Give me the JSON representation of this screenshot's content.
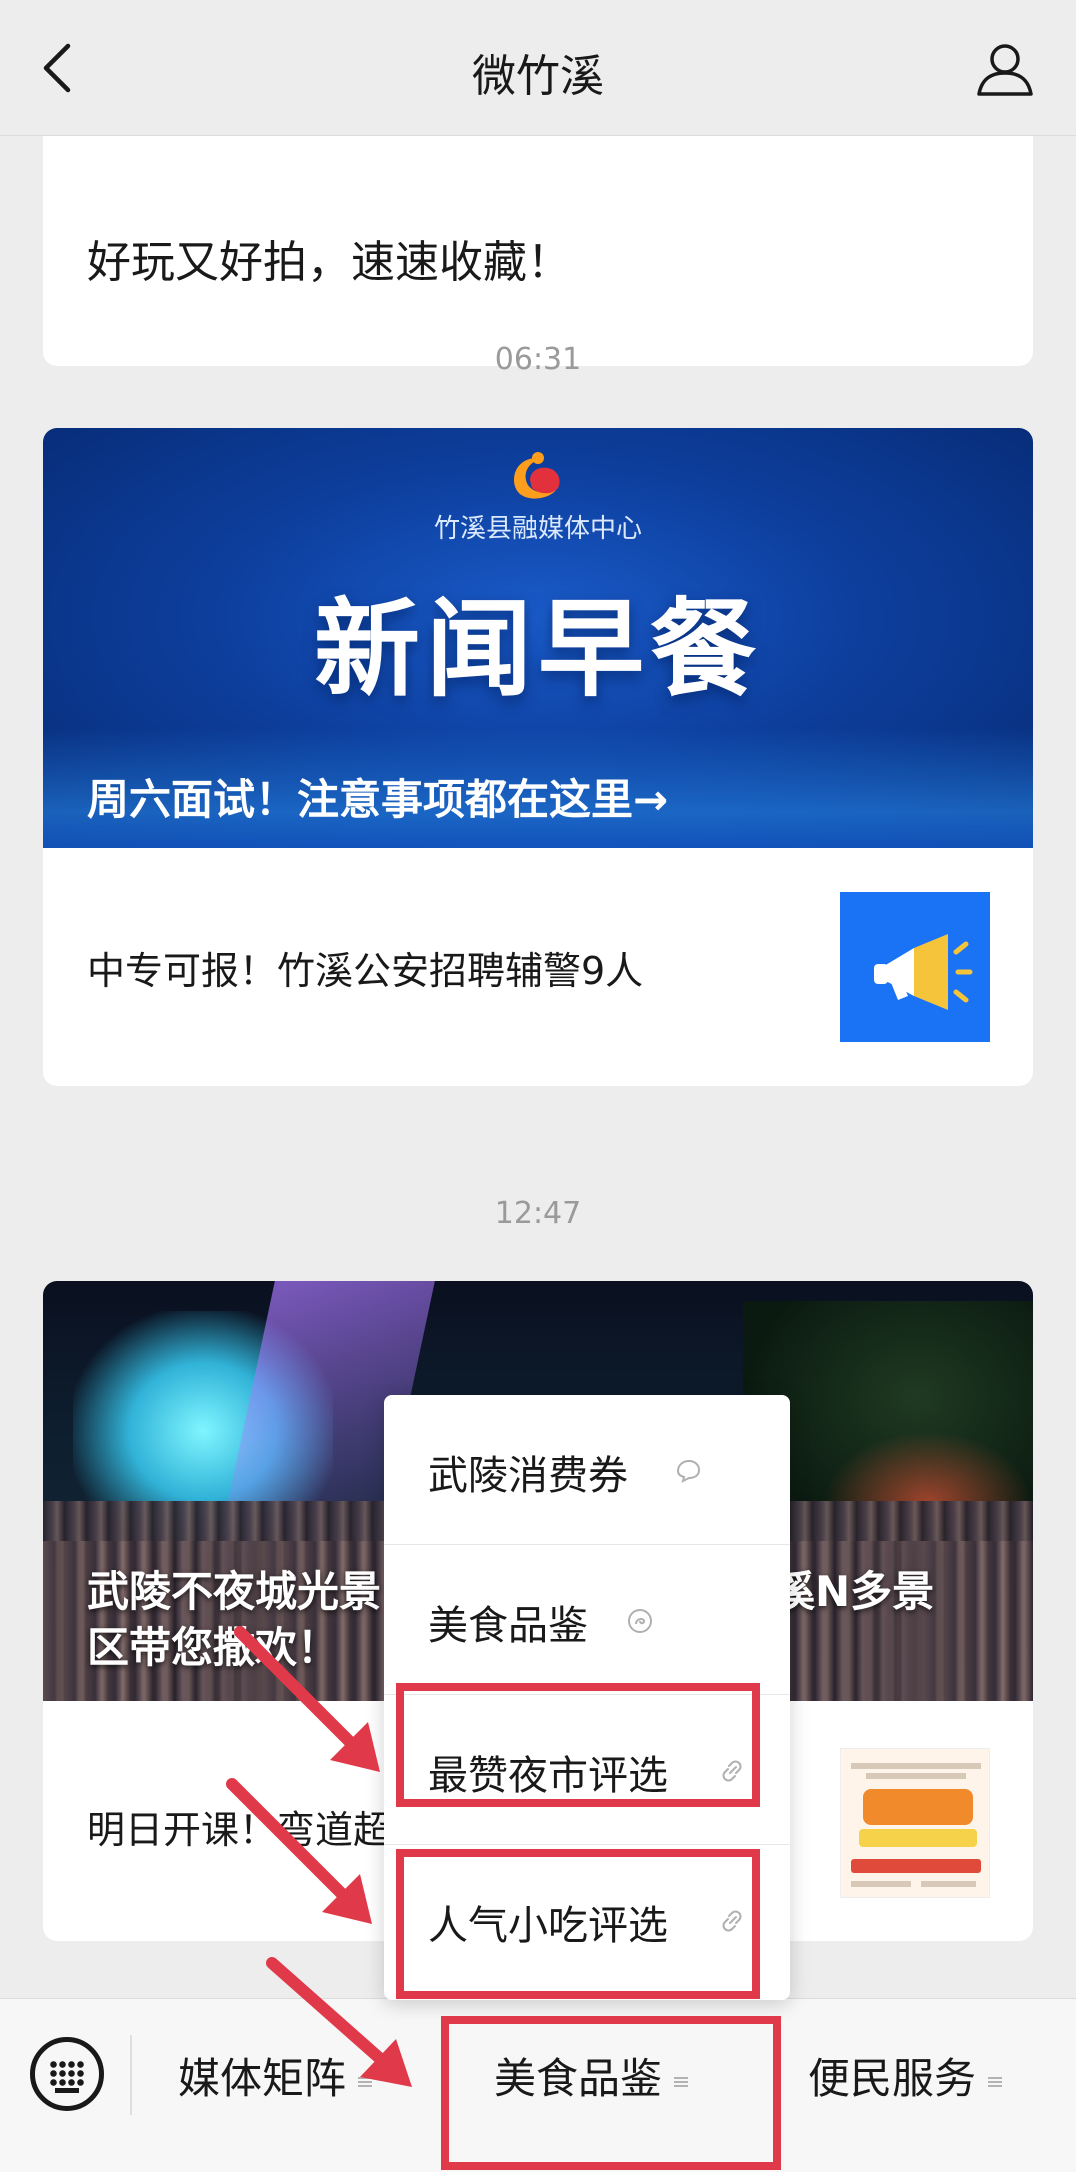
{
  "header": {
    "title": "微竹溪"
  },
  "top_card": {
    "summary": "好玩又好拍，速速收藏！"
  },
  "message1": {
    "time": "06:31",
    "banner": {
      "org_name": "竹溪县融媒体中心",
      "big_title": "新闻早餐",
      "caption": "周六面试！注意事项都在这里→"
    },
    "item": {
      "title": "中专可报！竹溪公安招聘辅警9人"
    }
  },
  "message2": {
    "time": "12:47",
    "banner": {
      "caption_left": "武陵不夜城光景",
      "caption_right": "竹溪N多景",
      "caption_line2": "区带您撒欢！"
    },
    "item": {
      "title": "明日开课！弯道超"
    },
    "poster": {
      "headline": "笔试8天8晚",
      "sub": "语文/数学/英语专项班",
      "date": "8月15日 竹溪开课"
    }
  },
  "popup_menu": {
    "items": [
      {
        "label": "武陵消费券",
        "icon": "mini-program-icon"
      },
      {
        "label": "美食品鉴",
        "icon": "mini-program-icon"
      },
      {
        "label": "最赞夜市评选",
        "icon": "link-icon"
      },
      {
        "label": "人气小吃评选",
        "icon": "link-icon"
      }
    ]
  },
  "bottom_menu": {
    "tabs": [
      {
        "label": "媒体矩阵"
      },
      {
        "label": "美食品鉴"
      },
      {
        "label": "便民服务"
      }
    ]
  },
  "colors": {
    "accent_red": "#e0394a",
    "banner_blue": "#0d3f9e",
    "megaphone_bg": "#1a73f5"
  }
}
